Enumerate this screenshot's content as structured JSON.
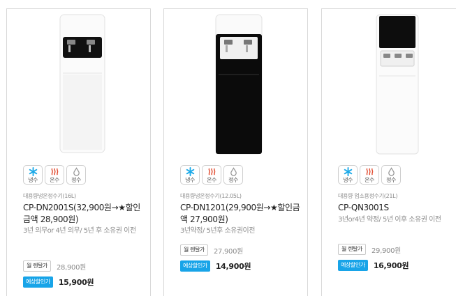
{
  "feature_labels": {
    "cold": "냉수",
    "hot": "온수",
    "purified": "정수"
  },
  "colors": {
    "accent": "#18a4e8",
    "hot_icon": "#e0492d",
    "cold_icon": "#1ba9e8",
    "neutral_icon": "#9a9a9a"
  },
  "products": [
    {
      "category": "대용량냉온정수기(16L)",
      "name": "CP-DN2001S(32,900원→★할인금액 28,900원)",
      "description": "3년 의무or 4년 의무/ 5년 후 소유권 이전",
      "rental_label": "월 렌탈가",
      "rental_price": "28,900원",
      "sale_label": "예상할인가",
      "sale_price": "15,900원"
    },
    {
      "category": "대용량냉온정수기(12.05L)",
      "name": "CP-DN1201(29,900원→★할인금액 27,900원)",
      "description": "3년약정/ 5년후 소유권이전",
      "rental_label": "월 렌탈가",
      "rental_price": "27,900원",
      "sale_label": "예상할인가",
      "sale_price": "14,900원"
    },
    {
      "category": "대용량 업소용정수기(21L)",
      "name": "CP-QN3001S",
      "description": "3년or4년 약정/ 5년 이후 소유권 이전",
      "rental_label": "월 렌탈가",
      "rental_price": "29,900원",
      "sale_label": "예상할인가",
      "sale_price": "16,900원"
    }
  ]
}
